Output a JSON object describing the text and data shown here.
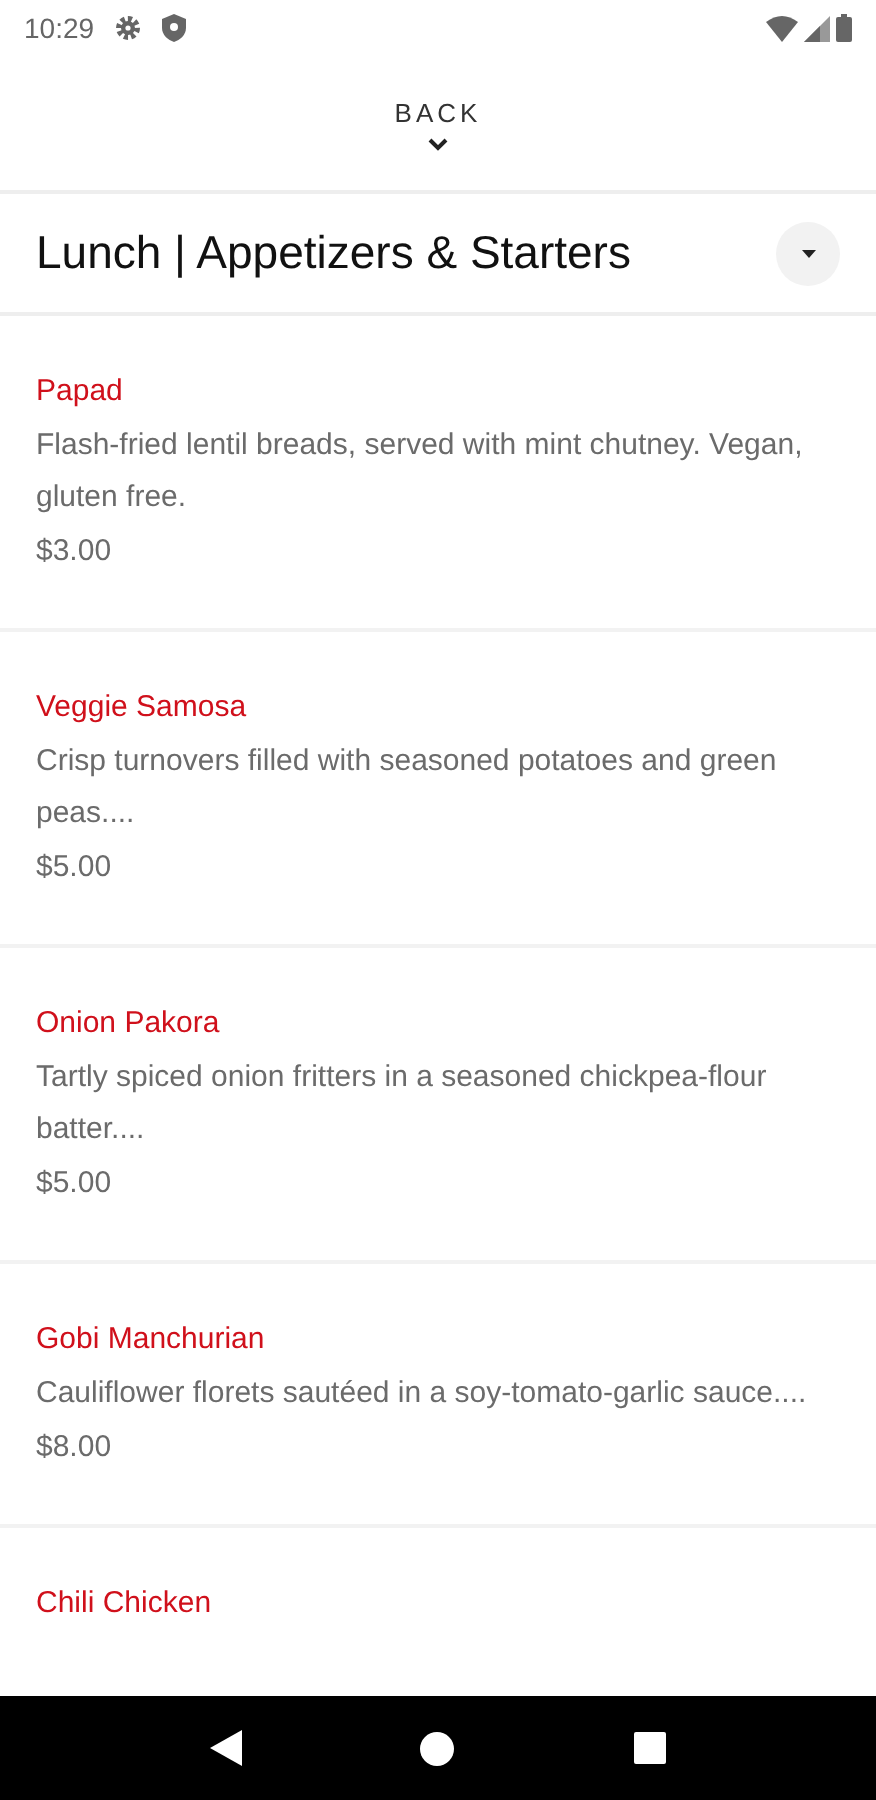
{
  "status_bar": {
    "time": "10:29"
  },
  "back": {
    "label": "BACK"
  },
  "header": {
    "title": "Lunch | Appetizers & Starters"
  },
  "items": [
    {
      "name": "Papad",
      "description": "Flash-fried lentil breads, served with mint chutney. Vegan, gluten free.",
      "price": "$3.00"
    },
    {
      "name": "Veggie Samosa",
      "description": "Crisp turnovers filled with seasoned potatoes and green peas....",
      "price": "$5.00"
    },
    {
      "name": "Onion Pakora",
      "description": "Tartly spiced onion fritters in a seasoned chickpea-flour batter....",
      "price": "$5.00"
    },
    {
      "name": "Gobi Manchurian",
      "description": "Cauliflower florets sautéed in a soy-tomato-garlic sauce....",
      "price": "$8.00"
    },
    {
      "name": "Chili Chicken"
    }
  ]
}
